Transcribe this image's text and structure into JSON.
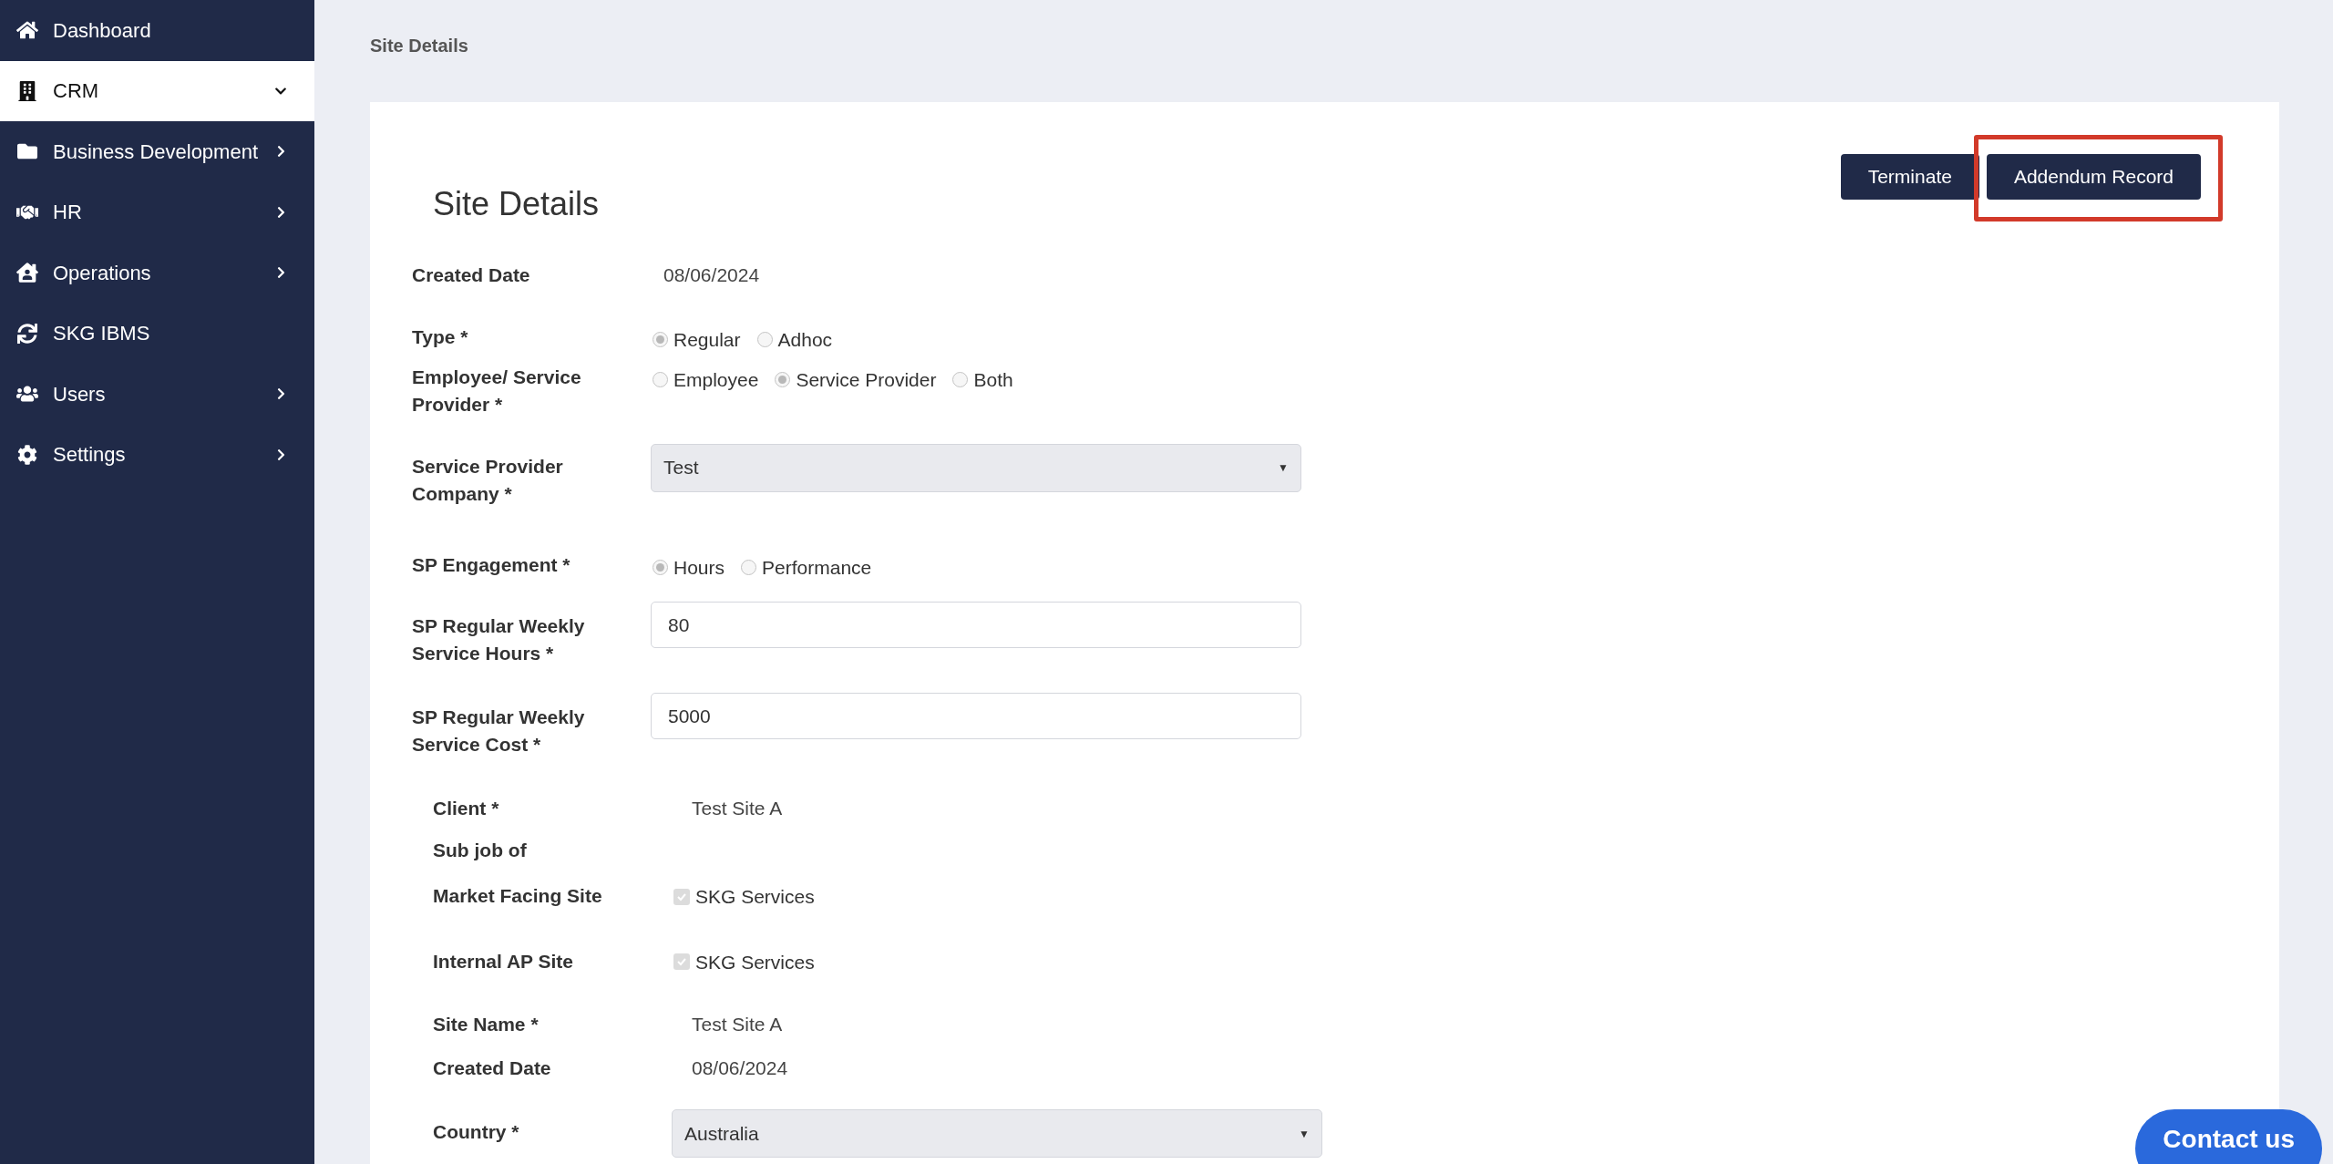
{
  "sidebar": {
    "items": [
      {
        "label": "Dashboard",
        "selected": false
      },
      {
        "label": "CRM",
        "selected": true,
        "expanded": true
      },
      {
        "label": "Business Development",
        "selected": false,
        "expanded": false
      },
      {
        "label": "HR",
        "selected": false,
        "expanded": false
      },
      {
        "label": "Operations",
        "selected": false,
        "expanded": false
      },
      {
        "label": "SKG IBMS",
        "selected": false
      },
      {
        "label": "Users",
        "selected": false,
        "expanded": false
      },
      {
        "label": "Settings",
        "selected": false,
        "expanded": false
      }
    ]
  },
  "breadcrumb": "Site Details",
  "card": {
    "title": "Site Details",
    "buttons": [
      {
        "label": "Terminate",
        "highlighted": false
      },
      {
        "label": "Addendum Record",
        "highlighted": true
      }
    ],
    "fields": [
      {
        "kind": "text",
        "label": "Created Date",
        "value": "08/06/2024"
      },
      {
        "kind": "radio",
        "label": "Type *",
        "options": [
          {
            "label": "Regular",
            "selected": true
          },
          {
            "label": "Adhoc",
            "selected": false
          }
        ]
      },
      {
        "kind": "radio",
        "label": "Employee/ Service Provider *",
        "options": [
          {
            "label": "Employee",
            "selected": false
          },
          {
            "label": "Service Provider",
            "selected": true
          },
          {
            "label": "Both",
            "selected": false
          }
        ]
      },
      {
        "kind": "select",
        "label": "Service Provider Company *",
        "value": "Test",
        "caret": "▼"
      },
      {
        "kind": "radio",
        "label": "SP Engagement *",
        "options": [
          {
            "label": "Hours",
            "selected": true
          },
          {
            "label": "Performance",
            "selected": false
          }
        ]
      },
      {
        "kind": "input",
        "label": "SP Regular Weekly Service Hours *",
        "value": "80"
      },
      {
        "kind": "input",
        "label": "SP Regular Weekly Service Cost *",
        "value": "5000"
      }
    ],
    "site_fields": [
      {
        "kind": "text",
        "label": "Client *",
        "value": "Test Site A"
      },
      {
        "kind": "text",
        "label": "Sub job of"
      },
      {
        "kind": "checkbox",
        "label": "Market Facing Site",
        "value": "SKG Services",
        "checked": true
      },
      {
        "kind": "checkbox",
        "label": "Internal AP Site",
        "value": "SKG Services",
        "checked": true
      },
      {
        "kind": "text",
        "label": "Site Name *",
        "value": "Test Site A"
      },
      {
        "kind": "text",
        "label": "Created Date",
        "value": "08/06/2024"
      },
      {
        "kind": "select",
        "label": "Country *",
        "value": "Australia",
        "caret": "▼"
      }
    ]
  },
  "contact_button": "Contact us"
}
